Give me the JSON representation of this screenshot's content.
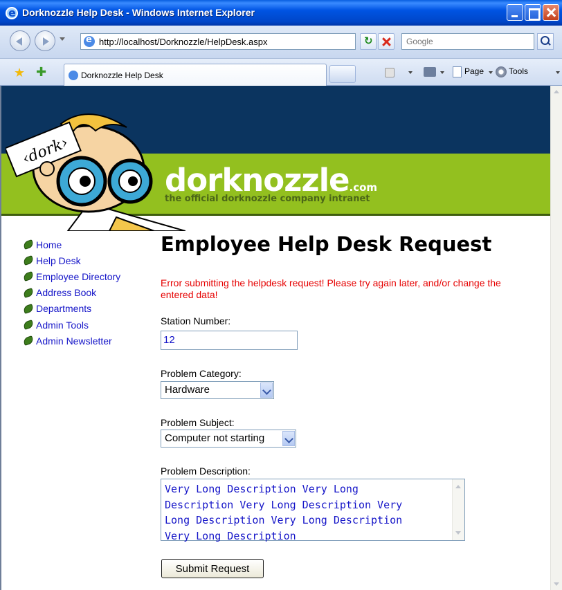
{
  "window": {
    "title": "Dorknozzle Help Desk - Windows Internet Explorer"
  },
  "addressbar": {
    "url": "http://localhost/Dorknozzle/HelpDesk.aspx",
    "search_placeholder": "Google"
  },
  "commandbar": {
    "tab_label": "Dorknozzle Help Desk",
    "page_label": "Page",
    "tools_label": "Tools"
  },
  "site": {
    "logo_name": "dorknozzle",
    "logo_suffix": ".com",
    "tagline": "the official dorknozzle company intranet",
    "mascot_sign": "‹dork›"
  },
  "sidebar": {
    "items": [
      {
        "label": "Home"
      },
      {
        "label": "Help Desk"
      },
      {
        "label": "Employee Directory"
      },
      {
        "label": "Address Book"
      },
      {
        "label": "Departments"
      },
      {
        "label": "Admin Tools"
      },
      {
        "label": "Admin Newsletter"
      }
    ]
  },
  "form": {
    "heading": "Employee Help Desk Request",
    "error_message": "Error submitting the helpdesk request! Please try again later, and/or change the entered data!",
    "station_label": "Station Number:",
    "station_value": "12",
    "category_label": "Problem Category:",
    "category_value": "Hardware",
    "subject_label": "Problem Subject:",
    "subject_value": "Computer not starting",
    "description_label": "Problem Description:",
    "description_value": "Very Long Description Very Long\nDescription Very Long Description Very\nLong Description Very Long Description\nVery Long Description",
    "submit_label": "Submit Request"
  },
  "colors": {
    "header_dark": "#0b345f",
    "header_green": "#93c01f",
    "link": "#1515c8",
    "error": "#e60000"
  }
}
